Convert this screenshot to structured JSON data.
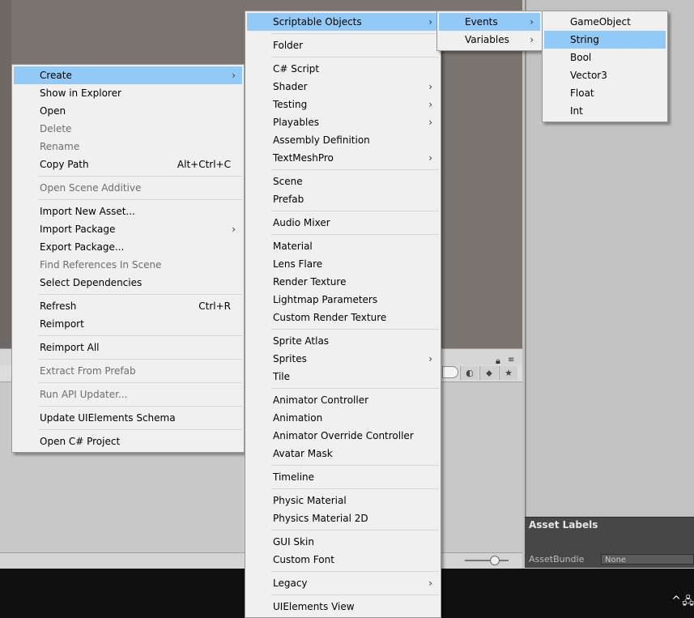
{
  "asset_labels": {
    "title": "Asset Labels",
    "bundle_label": "AssetBundle",
    "bundle_value": "None"
  },
  "context_menu": {
    "groups": [
      [
        {
          "label": "Create",
          "submenu": true,
          "highlighted": true
        },
        {
          "label": "Show in Explorer"
        },
        {
          "label": "Open"
        },
        {
          "label": "Delete",
          "disabled": true
        },
        {
          "label": "Rename",
          "disabled": true
        },
        {
          "label": "Copy Path",
          "shortcut": "Alt+Ctrl+C"
        }
      ],
      [
        {
          "label": "Open Scene Additive",
          "disabled": true
        }
      ],
      [
        {
          "label": "Import New Asset..."
        },
        {
          "label": "Import Package",
          "submenu": true
        },
        {
          "label": "Export Package..."
        },
        {
          "label": "Find References In Scene",
          "disabled": true
        },
        {
          "label": "Select Dependencies"
        }
      ],
      [
        {
          "label": "Refresh",
          "shortcut": "Ctrl+R"
        },
        {
          "label": "Reimport"
        }
      ],
      [
        {
          "label": "Reimport All"
        }
      ],
      [
        {
          "label": "Extract From Prefab",
          "disabled": true
        }
      ],
      [
        {
          "label": "Run API Updater...",
          "disabled": true
        }
      ],
      [
        {
          "label": "Update UIElements Schema"
        }
      ],
      [
        {
          "label": "Open C# Project"
        }
      ]
    ]
  },
  "create_menu": {
    "groups": [
      [
        {
          "label": "Scriptable Objects",
          "submenu": true,
          "highlighted": true
        }
      ],
      [
        {
          "label": "Folder"
        }
      ],
      [
        {
          "label": "C# Script"
        },
        {
          "label": "Shader",
          "submenu": true
        },
        {
          "label": "Testing",
          "submenu": true
        },
        {
          "label": "Playables",
          "submenu": true
        },
        {
          "label": "Assembly Definition"
        },
        {
          "label": "TextMeshPro",
          "submenu": true
        }
      ],
      [
        {
          "label": "Scene"
        },
        {
          "label": "Prefab"
        }
      ],
      [
        {
          "label": "Audio Mixer"
        }
      ],
      [
        {
          "label": "Material"
        },
        {
          "label": "Lens Flare"
        },
        {
          "label": "Render Texture"
        },
        {
          "label": "Lightmap Parameters"
        },
        {
          "label": "Custom Render Texture"
        }
      ],
      [
        {
          "label": "Sprite Atlas"
        },
        {
          "label": "Sprites",
          "submenu": true
        },
        {
          "label": "Tile"
        }
      ],
      [
        {
          "label": "Animator Controller"
        },
        {
          "label": "Animation"
        },
        {
          "label": "Animator Override Controller"
        },
        {
          "label": "Avatar Mask"
        }
      ],
      [
        {
          "label": "Timeline"
        }
      ],
      [
        {
          "label": "Physic Material"
        },
        {
          "label": "Physics Material 2D"
        }
      ],
      [
        {
          "label": "GUI Skin"
        },
        {
          "label": "Custom Font"
        }
      ],
      [
        {
          "label": "Legacy",
          "submenu": true
        }
      ],
      [
        {
          "label": "UIElements View"
        }
      ]
    ]
  },
  "scriptable_menu": {
    "groups": [
      [
        {
          "label": "Events",
          "submenu": true,
          "highlighted": true
        },
        {
          "label": "Variables",
          "submenu": true
        }
      ]
    ]
  },
  "events_menu": {
    "groups": [
      [
        {
          "label": "GameObject"
        },
        {
          "label": "String",
          "highlighted": true
        },
        {
          "label": "Bool"
        },
        {
          "label": "Vector3"
        },
        {
          "label": "Float"
        },
        {
          "label": "Int"
        }
      ]
    ]
  },
  "icons": {
    "submenu_arrow": "chevron-right-icon",
    "lock": "lock-icon",
    "panel_menu": "menu-icon"
  },
  "colors": {
    "highlight": "#91c9f7",
    "menu_bg": "#f0f0f0",
    "disabled_text": "#6d6d6d"
  }
}
